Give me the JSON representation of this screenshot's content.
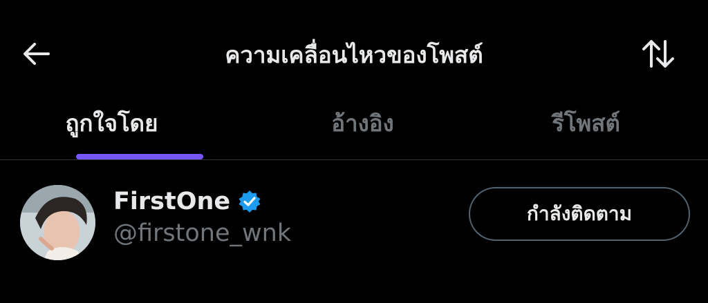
{
  "header": {
    "title": "ความเคลื่อนไหวของโพสต์",
    "back_icon": "arrow-left-icon",
    "sort_icon": "sort-arrows-icon"
  },
  "tabs": [
    {
      "label": "ถูกใจโดย",
      "active": true
    },
    {
      "label": "อ้างอิง",
      "active": false
    },
    {
      "label": "รีโพสต์",
      "active": false
    }
  ],
  "colors": {
    "background": "#000000",
    "primary_text": "#e7e9ea",
    "secondary_text": "#71767b",
    "tab_indicator": "#7856ff",
    "verified_badge": "#1d9bf0",
    "button_border": "#536471"
  },
  "user": {
    "display_name": "FirstOne",
    "handle": "@firstone_wnk",
    "verified": true,
    "follow_button_label": "กำลังติดตาม"
  }
}
